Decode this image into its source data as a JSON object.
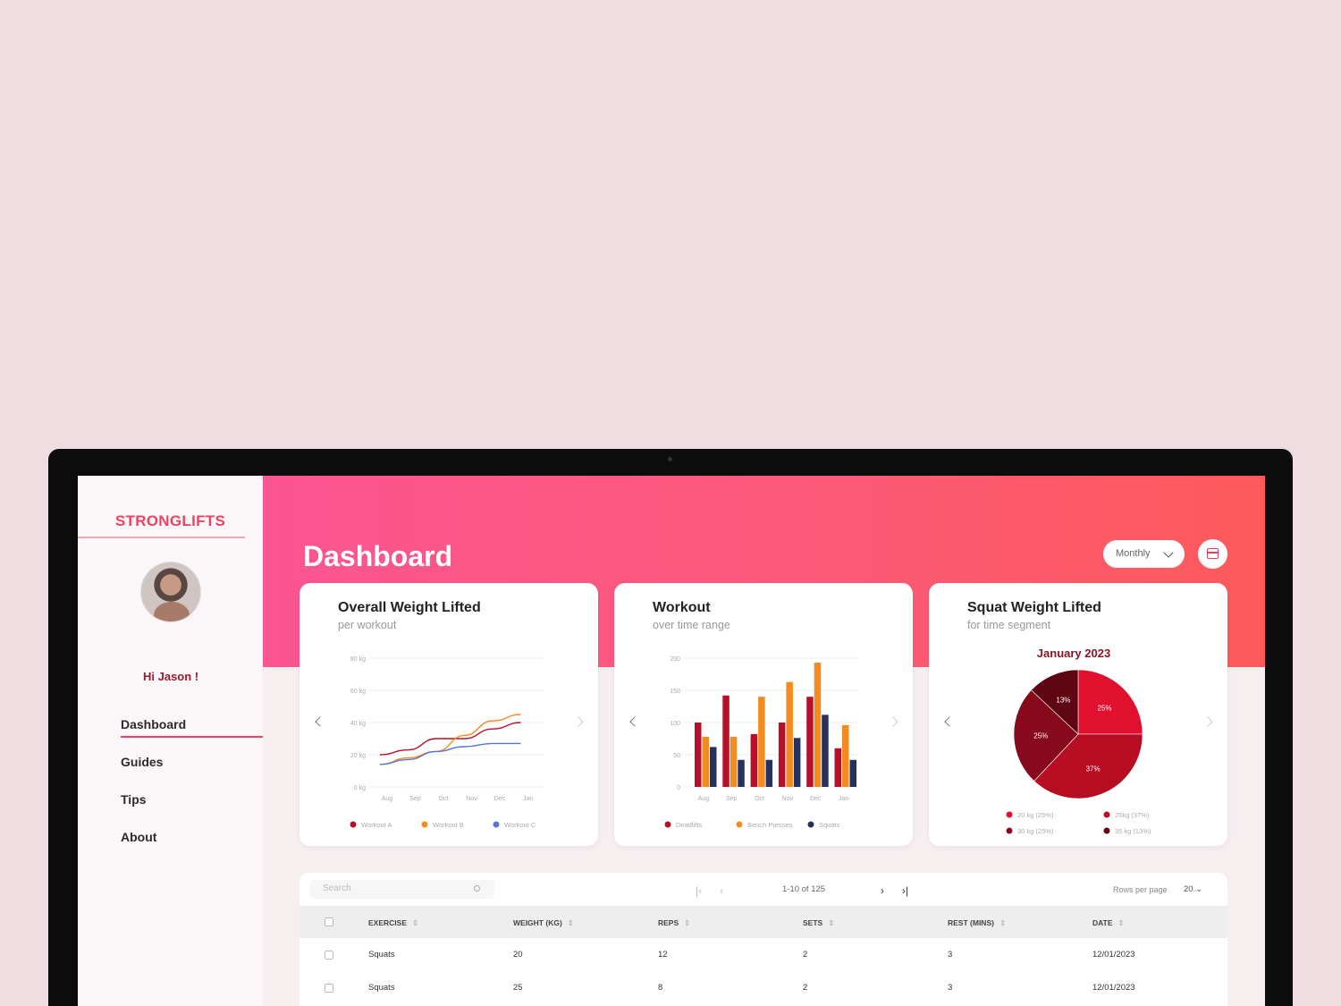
{
  "app": {
    "name": "STRONGLIFTS",
    "greeting": "Hi Jason !"
  },
  "nav": [
    {
      "label": "Dashboard",
      "active": true
    },
    {
      "label": "Guides"
    },
    {
      "label": "Tips"
    },
    {
      "label": "About"
    }
  ],
  "header": {
    "title": "Dashboard",
    "period": "Monthly"
  },
  "colors": {
    "accent": "#ee4360",
    "workout_a": "#b8102a",
    "workout_b": "#f58a1f",
    "workout_c": "#5577cc",
    "squats_bar": "#26325e"
  },
  "icons": [
    "calendar-icon",
    "chevron-down-icon",
    "search-icon",
    "chevron-left-icon",
    "chevron-right-icon"
  ],
  "cards": [
    {
      "title": "Overall Weight Lifted",
      "subtitle": "per workout"
    },
    {
      "title": "Workout",
      "subtitle": "over time range"
    },
    {
      "title": "Squat Weight Lifted",
      "subtitle": "for time segment",
      "segment": "January 2023"
    }
  ],
  "chart_data": [
    {
      "type": "line",
      "x": [
        "Aug",
        "Sep",
        "Oct",
        "Nov",
        "Dec",
        "Jan"
      ],
      "ylim": [
        0,
        80
      ],
      "y_ticks": [
        "0 kg",
        "20 kg",
        "40 kg",
        "60 kg",
        "80 kg"
      ],
      "grid": true,
      "series": [
        {
          "name": "Workout A",
          "color": "#b8102a",
          "values": [
            20,
            23,
            30,
            30,
            36,
            40
          ]
        },
        {
          "name": "Workout B",
          "color": "#f58a1f",
          "values": [
            14,
            18,
            22,
            32,
            41,
            45
          ]
        },
        {
          "name": "Workout C",
          "color": "#5577cc",
          "values": [
            14,
            17,
            22,
            25,
            27,
            27
          ]
        }
      ]
    },
    {
      "type": "bar",
      "categories": [
        "Aug",
        "Sep",
        "Oct",
        "Nov",
        "Dec",
        "Jan"
      ],
      "ylim": [
        0,
        200
      ],
      "y_ticks": [
        "0",
        "50",
        "100",
        "150",
        "200"
      ],
      "grid": true,
      "series": [
        {
          "name": "Deadlifts",
          "color": "#b8102a",
          "values": [
            100,
            142,
            82,
            100,
            140,
            60
          ]
        },
        {
          "name": "Bench Presses",
          "color": "#f58a1f",
          "values": [
            78,
            78,
            140,
            163,
            193,
            96
          ]
        },
        {
          "name": "Squats",
          "color": "#26325e",
          "values": [
            62,
            42,
            42,
            76,
            112,
            42
          ]
        }
      ]
    },
    {
      "type": "pie",
      "title": "January 2023",
      "slices": [
        {
          "label": "25%",
          "value": 25,
          "color": "#e0102e",
          "legend": "20 kg (25%)"
        },
        {
          "label": "37%",
          "value": 37,
          "color": "#b80c22",
          "legend": "25kg (37%)"
        },
        {
          "label": "25%",
          "value": 25,
          "color": "#860a1c",
          "legend": "30 kg (25%)"
        },
        {
          "label": "13%",
          "value": 13,
          "color": "#5e0713",
          "legend": "35 kg (13%)"
        }
      ]
    }
  ],
  "table": {
    "search_placeholder": "Search",
    "pagination": "1-10 of 125",
    "rows_per_page_label": "Rows per page",
    "rows_per_page": "20",
    "columns": [
      "EXERCISE",
      "WEIGHT (KG)",
      "REPS",
      "SETS",
      "REST (MINS)",
      "DATE"
    ],
    "rows": [
      [
        "Squats",
        "20",
        "12",
        "2",
        "3",
        "12/01/2023"
      ],
      [
        "Squats",
        "25",
        "8",
        "2",
        "3",
        "12/01/2023"
      ]
    ]
  }
}
